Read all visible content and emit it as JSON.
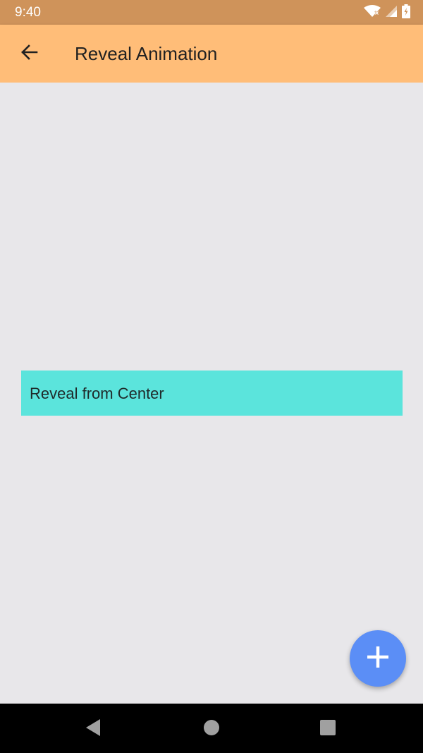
{
  "status_bar": {
    "time": "9:40",
    "icons": [
      "wifi-icon",
      "signal-icon",
      "battery-icon"
    ]
  },
  "app_bar": {
    "back_icon": "arrow-back-icon",
    "title": "Reveal Animation"
  },
  "content": {
    "reveal_label": "Reveal from Center"
  },
  "fab": {
    "icon": "plus-icon"
  },
  "nav_bar": {
    "buttons": [
      "back-triangle-icon",
      "home-circle-icon",
      "recents-square-icon"
    ]
  },
  "colors": {
    "status_bar": "#cf935a",
    "app_bar": "#ffbd78",
    "background": "#e8e7ea",
    "reveal_banner": "#5be4dc",
    "fab": "#5b8ef6",
    "nav_bar": "#000000"
  }
}
